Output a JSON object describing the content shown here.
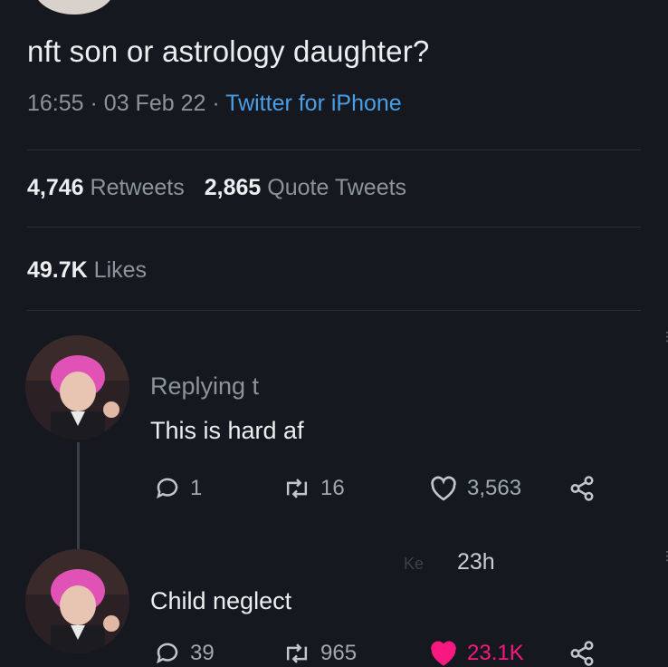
{
  "tweet": {
    "text": "nft son or astrology daughter?",
    "time": "16:55",
    "date": "03 Feb 22",
    "separator": "·",
    "source": "Twitter for iPhone"
  },
  "stats": {
    "retweets_count": "4,746",
    "retweets_label": "Retweets",
    "quotes_count": "2,865",
    "quotes_label": "Quote Tweets",
    "likes_count": "49.7K",
    "likes_label": "Likes"
  },
  "replies": [
    {
      "replying_to": "Replying t",
      "text": "This is hard af",
      "reply_count": "1",
      "retweet_count": "16",
      "like_count": "3,563",
      "liked": false
    },
    {
      "time": "23h",
      "text": "Child neglect",
      "reply_count": "39",
      "retweet_count": "965",
      "like_count": "23.1K",
      "liked": true
    }
  ],
  "colors": {
    "background": "#15181f",
    "link": "#4a9ee6",
    "like_active": "#f91880",
    "muted": "#8b949c"
  },
  "icons": {
    "reply": "reply-icon",
    "retweet": "retweet-icon",
    "like": "heart-icon",
    "share": "share-icon"
  }
}
